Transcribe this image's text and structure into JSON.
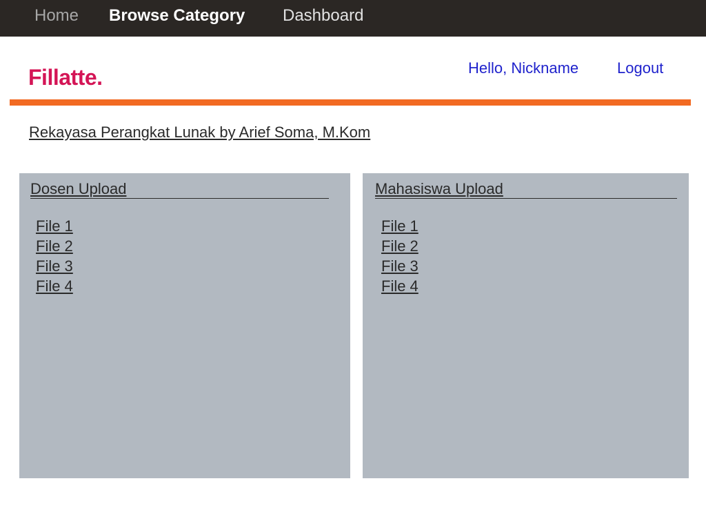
{
  "nav": {
    "home": "Home",
    "browse_category": "Browse Category",
    "dashboard": "Dashboard"
  },
  "header": {
    "logo": "Fillatte.",
    "greeting": "Hello, Nickname",
    "logout": "Logout"
  },
  "course": {
    "title": "Rekayasa Perangkat Lunak by Arief Soma, M.Kom"
  },
  "panels": [
    {
      "heading": "Dosen Upload",
      "files": [
        "File 1",
        "File 2",
        "File 3",
        "File 4"
      ]
    },
    {
      "heading": "Mahasiswa Upload",
      "files": [
        "File 1",
        "File 2",
        "File 3",
        "File 4"
      ]
    }
  ],
  "colors": {
    "nav_bg": "#2b2724",
    "logo": "#d41556",
    "link_blue": "#1f22cc",
    "accent_rule": "#f26a22",
    "panel_bg": "#b2b9c1"
  }
}
